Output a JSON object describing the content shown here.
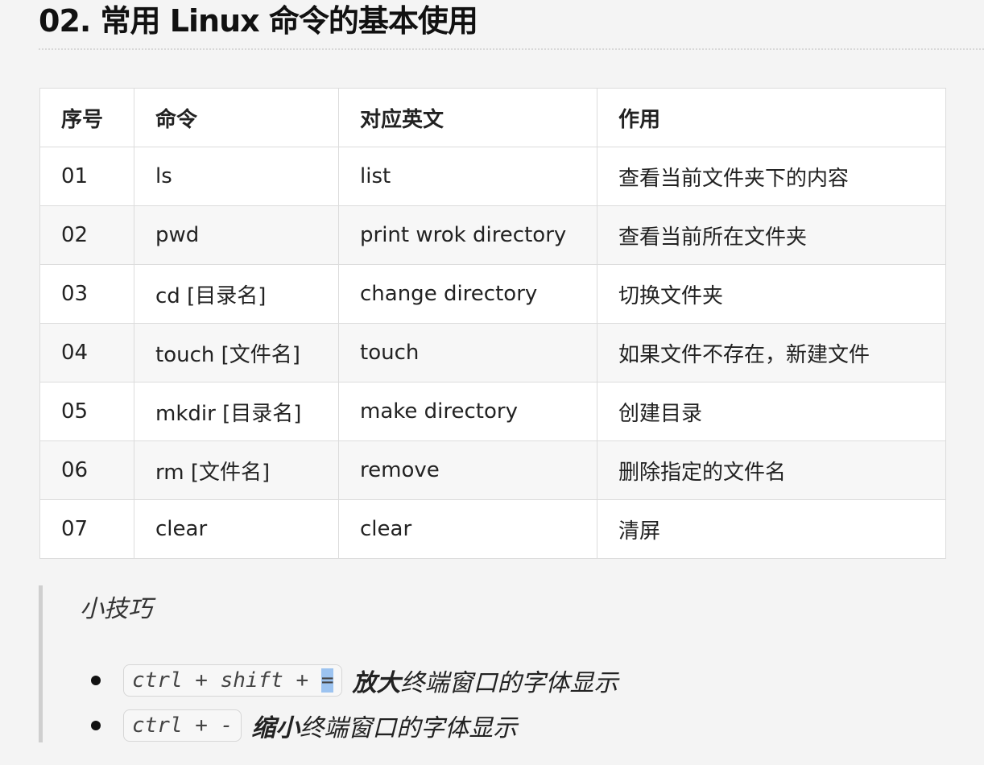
{
  "title": "02. 常用 Linux 命令的基本使用",
  "table": {
    "headers": [
      "序号",
      "命令",
      "对应英文",
      "作用"
    ],
    "rows": [
      [
        "01",
        "ls",
        "list",
        "查看当前文件夹下的内容"
      ],
      [
        "02",
        "pwd",
        "print wrok directory",
        "查看当前所在文件夹"
      ],
      [
        "03",
        "cd [目录名]",
        "change directory",
        "切换文件夹"
      ],
      [
        "04",
        "touch [文件名]",
        "touch",
        "如果文件不存在，新建文件"
      ],
      [
        "05",
        "mkdir [目录名]",
        "make directory",
        "创建目录"
      ],
      [
        "06",
        "rm [文件名]",
        "remove",
        "删除指定的文件名"
      ],
      [
        "07",
        "clear",
        "clear",
        "清屏"
      ]
    ]
  },
  "tips": {
    "title": "小技巧",
    "items": [
      {
        "key_prefix": "ctrl + shift + ",
        "key_selected": "=",
        "strong": "放大",
        "text": "终端窗口的字体显示"
      },
      {
        "key_prefix": "ctrl + -",
        "key_selected": "",
        "strong": "缩小",
        "text": "终端窗口的字体显示"
      }
    ]
  },
  "colors": {
    "selection": "#9cc3f0"
  }
}
